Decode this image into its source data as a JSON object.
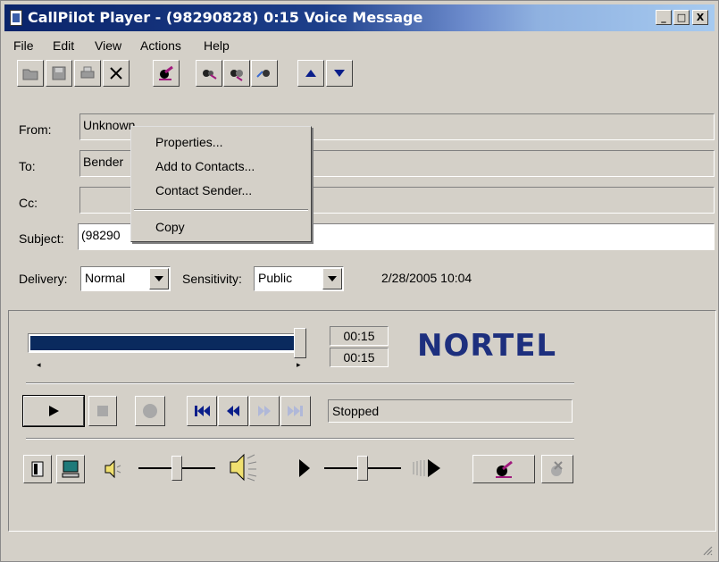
{
  "window": {
    "title": "CallPilot Player - (98290828) 0:15 Voice Message",
    "controls": {
      "minimize": "_",
      "maximize": "□",
      "close": "X"
    }
  },
  "menubar": {
    "items": [
      {
        "label": "File",
        "mnemonic": "F"
      },
      {
        "label": "Edit",
        "mnemonic": "E"
      },
      {
        "label": "View",
        "mnemonic": "V"
      },
      {
        "label": "Actions",
        "mnemonic": "A"
      },
      {
        "label": "Help",
        "mnemonic": "H"
      }
    ]
  },
  "toolbar": {
    "icons": [
      "open-folder-icon",
      "save-icon",
      "print-icon",
      "delete-icon",
      "reply-icon",
      "reply-all-icon",
      "forward-icon",
      "forward-all-icon",
      "previous-message-icon",
      "next-message-icon"
    ]
  },
  "header": {
    "from_label": "From:",
    "from_value": "Unknown",
    "to_label": "To:",
    "to_value": "Bender",
    "cc_label": "Cc:",
    "cc_value": "",
    "subject_label": "Subject:",
    "subject_value": "(98290",
    "delivery_label": "Delivery:",
    "delivery_value": "Normal",
    "sensitivity_label": "Sensitivity:",
    "sensitivity_value": "Public",
    "datetime": "2/28/2005 10:04"
  },
  "context_menu": {
    "items": [
      "Properties...",
      "Add to Contacts...",
      "Contact Sender...",
      "Copy"
    ]
  },
  "player": {
    "progress_fraction": 1.0,
    "elapsed": "00:15",
    "total": "00:15",
    "brand": "NORTEL",
    "status": "Stopped",
    "volume_level": 0.5,
    "speed_level": 0.5
  },
  "colors": {
    "title_start": "#0a246a",
    "title_end": "#a6caf0",
    "progress": "#0a2a5e",
    "brand": "#1d2f7e",
    "face": "#d4d0c8"
  }
}
